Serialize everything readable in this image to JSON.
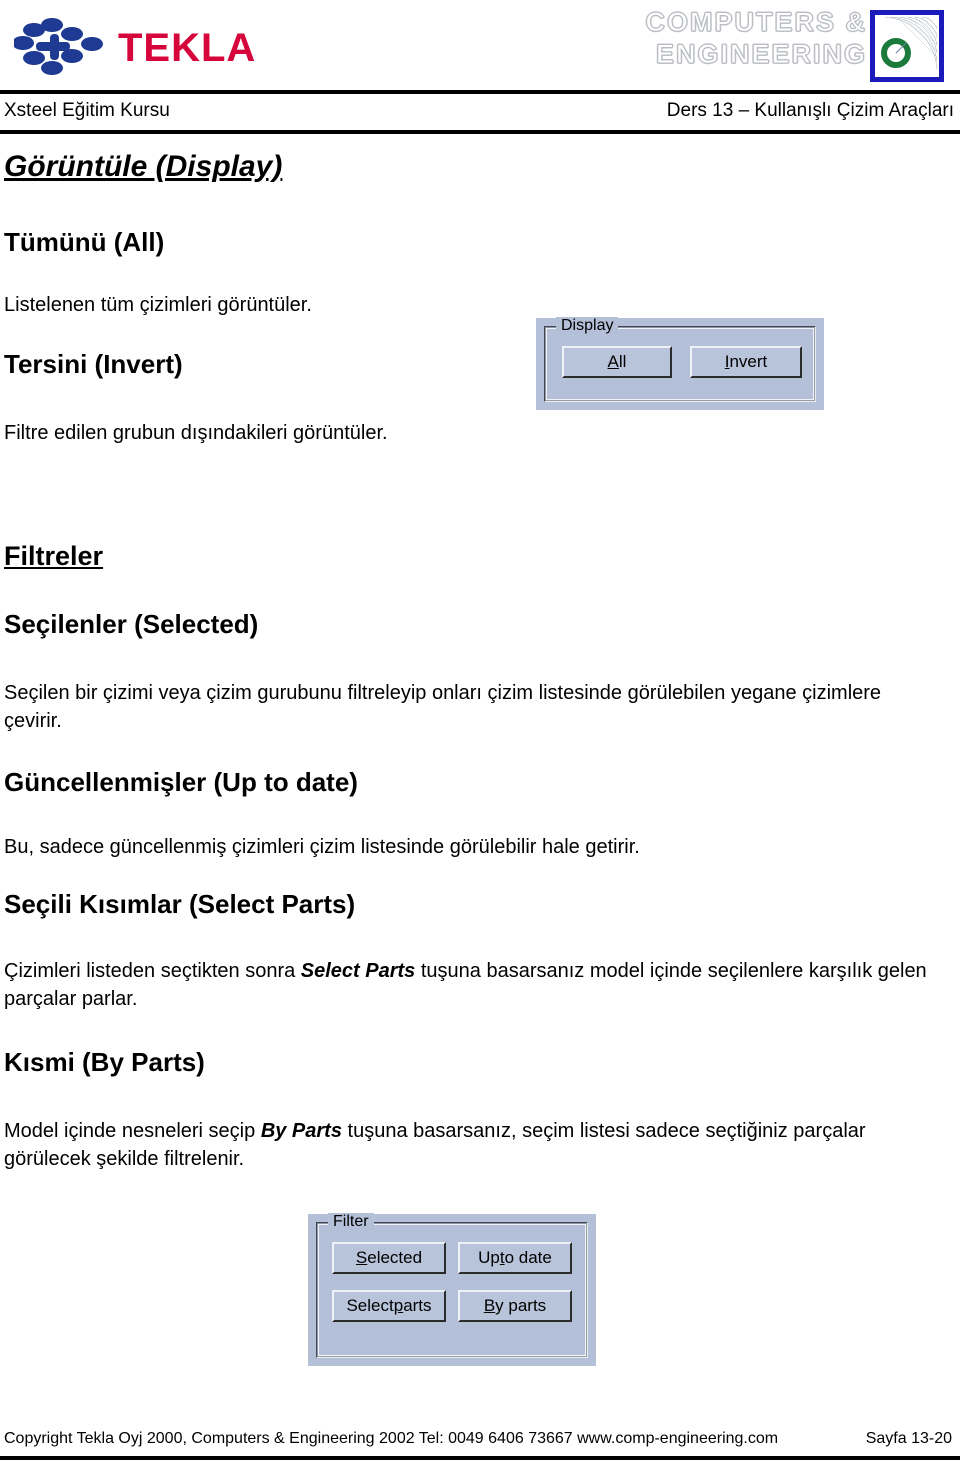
{
  "header": {
    "brand_name": "TEKLA",
    "brand_color": "#d6063c",
    "logo_mark_color": "#1f3a93",
    "partner_line1": "COMPUTERS &",
    "partner_line2": "ENGINEERING",
    "partner_badge_border_color": "#1b1bbd",
    "partner_badge_ring_color": "#1a7a3c",
    "left_title": "Xsteel Eğitim Kursu",
    "right_title": "Ders 13 – Kullanışlı Çizim Araçları"
  },
  "content": {
    "display_heading": "Görüntüle (Display)",
    "all_heading": "Tümünü (All)",
    "all_text": "Listelenen tüm çizimleri görüntüler.",
    "invert_heading": "Tersini (Invert)",
    "invert_text": "Filtre edilen grubun dışındakileri görüntüler.",
    "filters_heading": "Filtreler",
    "selected_heading": "Seçilenler  (Selected)",
    "selected_text": "Seçilen bir çizimi veya çizim gurubunu filtreleyip onları çizim listesinde görülebilen yegane çizimlere çevirir.",
    "uptodate_heading": "Güncellenmişler (Up to date)",
    "uptodate_text": "Bu, sadece güncellenmiş çizimleri çizim listesinde görülebilir hale getirir.",
    "selectparts_heading": "Seçili Kısımlar (Select Parts)",
    "selectparts_text_a": "Çizimleri listeden seçtikten sonra ",
    "selectparts_text_bold": "Select Parts",
    "selectparts_text_b": " tuşuna basarsanız model içinde seçilenlere karşılık gelen parçalar parlar.",
    "byparts_heading": "Kısmi (By Parts)",
    "byparts_text_a": "Model içinde nesneleri seçip ",
    "byparts_text_bold": "By Parts",
    "byparts_text_b": " tuşuna basarsanız, seçim listesi sadece seçtiğiniz parçalar görülecek şekilde filtrelenir."
  },
  "display_dialog": {
    "group_title": "Display",
    "face_color": "#b4c0d8",
    "buttons": [
      {
        "label": "All",
        "accel": "A",
        "rest": "ll"
      },
      {
        "label": "Invert",
        "accel": "I",
        "rest": "nvert"
      }
    ]
  },
  "filter_dialog": {
    "group_title": "Filter",
    "face_color": "#b4c0d8",
    "buttons": [
      {
        "label": "Selected",
        "pre": "",
        "accel": "S",
        "rest": "elected"
      },
      {
        "label": "Up to date",
        "pre": "Up ",
        "accel": "t",
        "rest": "o date"
      },
      {
        "label": "Select parts",
        "pre": "Select ",
        "accel": "p",
        "rest": "arts"
      },
      {
        "label": "By parts",
        "pre": "",
        "accel": "B",
        "rest": "y parts"
      }
    ]
  },
  "footer": {
    "copyright": "Copyright Tekla Oyj 2000,  Computers & Engineering 2002  Tel: 0049 6406 73667   www.comp-engineering.com",
    "page": "Sayfa 13-20"
  }
}
